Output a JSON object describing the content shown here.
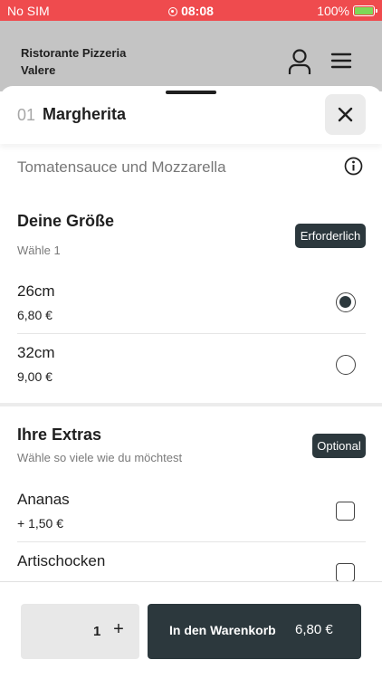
{
  "status_bar": {
    "carrier": "No SIM",
    "time": "08:08",
    "battery": "100%",
    "background_color": "#ef4b4e"
  },
  "header": {
    "restaurant_name": "Ristorante Pizzeria Valere",
    "user_icon": "user-icon",
    "menu_icon": "hamburger-menu-icon"
  },
  "product": {
    "number": "01",
    "name": "Margherita",
    "description": "Tomatensauce und Mozzarella",
    "close_icon": "close-icon",
    "info_icon": "info-icon"
  },
  "size_section": {
    "title": "Deine Größe",
    "subtitle": "Wähle 1",
    "badge": "Erforderlich",
    "options": [
      {
        "name": "26cm",
        "price": "6,80 €",
        "selected": true
      },
      {
        "name": "32cm",
        "price": "9,00 €",
        "selected": false
      }
    ]
  },
  "extras_section": {
    "title": "Ihre Extras",
    "subtitle": "Wähle so viele wie du möchtest",
    "badge": "Optional",
    "options": [
      {
        "name": "Ananas",
        "price": "+ 1,50 €",
        "checked": false
      },
      {
        "name": "Artischocken",
        "price": "",
        "checked": false
      }
    ]
  },
  "footer": {
    "quantity": "1",
    "plus_label": "+",
    "cart_label": "In den Warenkorb",
    "cart_price": "6,80 €"
  },
  "colors": {
    "accent_dark": "#2c383d",
    "header_bg": "#c4c4c4"
  }
}
